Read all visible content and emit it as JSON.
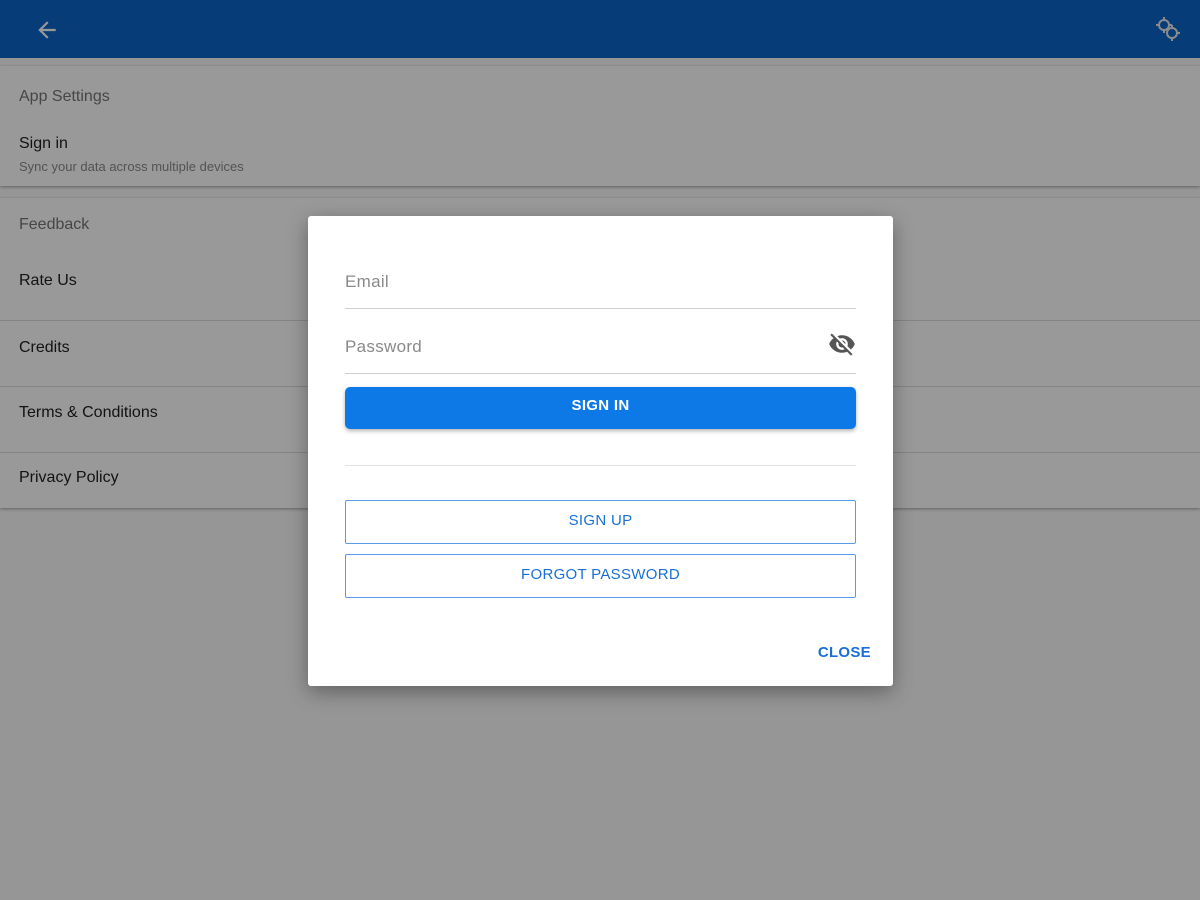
{
  "appbar": {
    "back_icon": "arrow-back-icon",
    "settings_icon": "gears-icon",
    "color": "#0a66c9"
  },
  "settings": {
    "app_settings": {
      "title": "App Settings",
      "sign_in": {
        "title": "Sign in",
        "subtitle": "Sync your data across multiple devices"
      }
    },
    "feedback": {
      "title": "Feedback",
      "items": [
        {
          "label": "Rate Us"
        },
        {
          "label": "Credits"
        },
        {
          "label": "Terms & Conditions"
        },
        {
          "label": "Privacy Policy"
        }
      ]
    }
  },
  "dialog": {
    "email": {
      "placeholder": "Email",
      "value": ""
    },
    "password": {
      "placeholder": "Password",
      "value": "",
      "toggle_icon": "visibility-off-icon"
    },
    "sign_in_label": "SIGN IN",
    "sign_up_label": "SIGN UP",
    "forgot_label": "FORGOT PASSWORD",
    "close_label": "CLOSE",
    "accent_color": "#0d79e6"
  }
}
